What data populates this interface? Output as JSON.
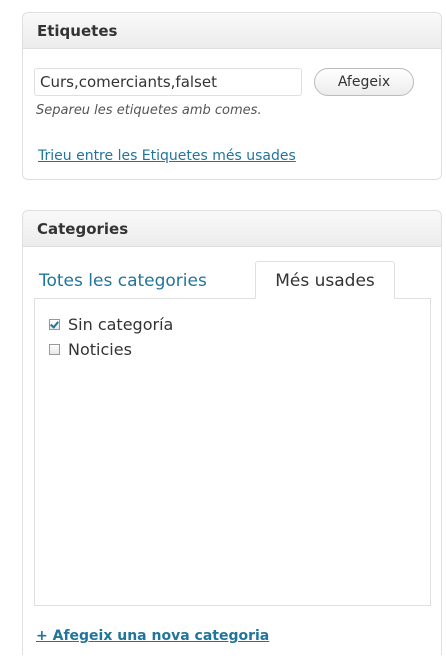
{
  "tags": {
    "title": "Etiquetes",
    "input_value": "Curs,comerciants,falset",
    "add_button": "Afegeix",
    "hint": "Separeu les etiquetes amb comes.",
    "popular_link": "Trieu entre les Etiquetes més usades"
  },
  "categories": {
    "title": "Categories",
    "tabs": [
      {
        "label": "Totes les categories",
        "active": false
      },
      {
        "label": "Més usades",
        "active": true
      }
    ],
    "items": [
      {
        "label": "Sin categoría",
        "checked": true
      },
      {
        "label": "Noticies",
        "checked": false
      }
    ],
    "add_link": "+ Afegeix una nova categoria"
  },
  "colors": {
    "link": "#21759b",
    "text": "#333333",
    "border": "#dfdfdf"
  }
}
